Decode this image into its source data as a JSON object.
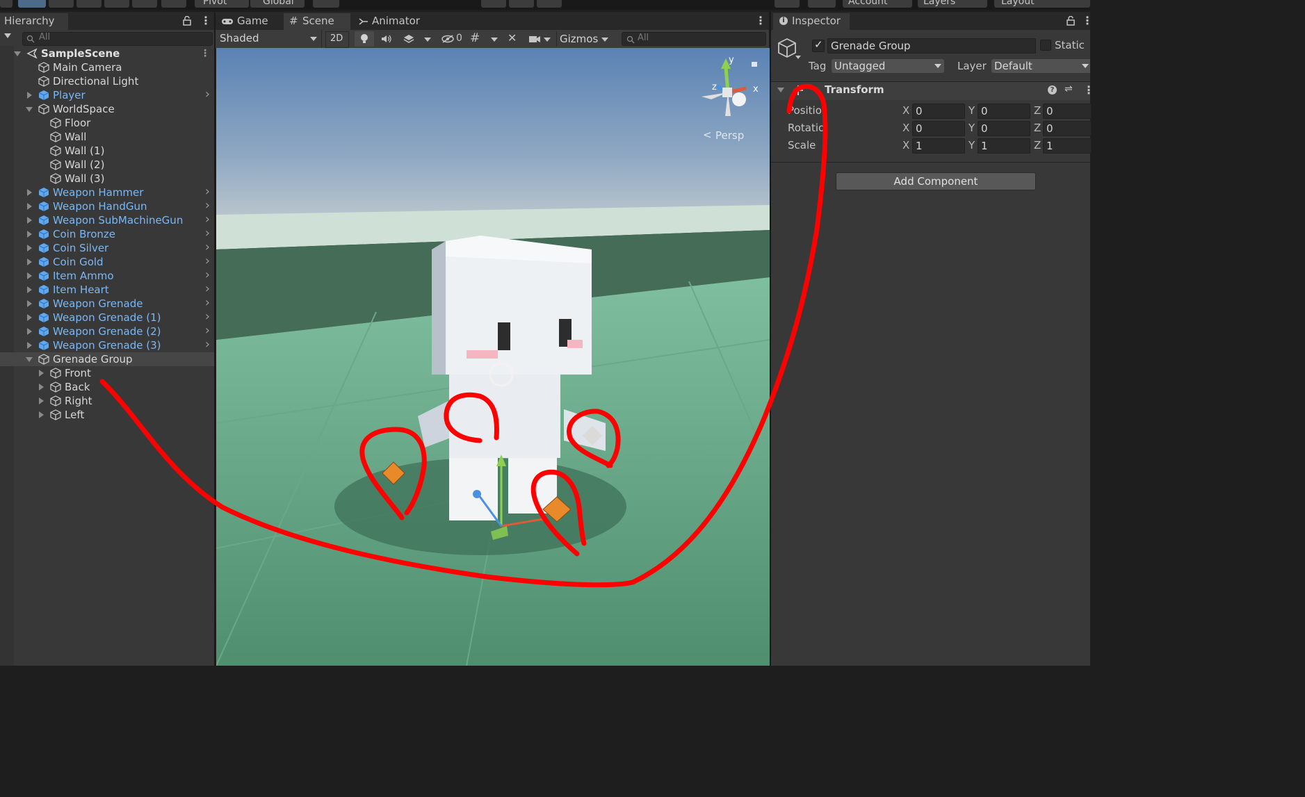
{
  "toolbar": {
    "pivot_label": "Pivot",
    "global_label": "Global",
    "account_label": "Account",
    "layers_label": "Layers",
    "layout_label": "Layout"
  },
  "hierarchy": {
    "title": "Hierarchy",
    "search_placeholder": "All",
    "items": [
      {
        "label": "SampleScene",
        "indent": 0,
        "fold": "down",
        "icon": "unity-scene-icon",
        "style": "bold",
        "chevron": false
      },
      {
        "label": "Main Camera",
        "indent": 1,
        "fold": "none",
        "icon": "gameobject-cube-icon",
        "style": "white",
        "chevron": false
      },
      {
        "label": "Directional Light",
        "indent": 1,
        "fold": "none",
        "icon": "gameobject-cube-icon",
        "style": "white",
        "chevron": false
      },
      {
        "label": "Player",
        "indent": 1,
        "fold": "right",
        "icon": "prefab-cube-icon",
        "style": "blue",
        "chevron": true
      },
      {
        "label": "WorldSpace",
        "indent": 1,
        "fold": "down",
        "icon": "gameobject-cube-icon",
        "style": "white",
        "chevron": false
      },
      {
        "label": "Floor",
        "indent": 2,
        "fold": "none",
        "icon": "gameobject-cube-icon",
        "style": "white",
        "chevron": false
      },
      {
        "label": "Wall",
        "indent": 2,
        "fold": "none",
        "icon": "gameobject-cube-icon",
        "style": "white",
        "chevron": false
      },
      {
        "label": "Wall (1)",
        "indent": 2,
        "fold": "none",
        "icon": "gameobject-cube-icon",
        "style": "white",
        "chevron": false
      },
      {
        "label": "Wall (2)",
        "indent": 2,
        "fold": "none",
        "icon": "gameobject-cube-icon",
        "style": "white",
        "chevron": false
      },
      {
        "label": "Wall (3)",
        "indent": 2,
        "fold": "none",
        "icon": "gameobject-cube-icon",
        "style": "white",
        "chevron": false
      },
      {
        "label": "Weapon Hammer",
        "indent": 1,
        "fold": "right",
        "icon": "prefab-cube-icon",
        "style": "blue",
        "chevron": true
      },
      {
        "label": "Weapon HandGun",
        "indent": 1,
        "fold": "right",
        "icon": "prefab-cube-icon",
        "style": "blue",
        "chevron": true
      },
      {
        "label": "Weapon SubMachineGun",
        "indent": 1,
        "fold": "right",
        "icon": "prefab-cube-icon",
        "style": "blue",
        "chevron": true
      },
      {
        "label": "Coin Bronze",
        "indent": 1,
        "fold": "right",
        "icon": "prefab-cube-icon",
        "style": "blue",
        "chevron": true
      },
      {
        "label": "Coin Silver",
        "indent": 1,
        "fold": "right",
        "icon": "prefab-cube-icon",
        "style": "blue",
        "chevron": true
      },
      {
        "label": "Coin Gold",
        "indent": 1,
        "fold": "right",
        "icon": "prefab-cube-icon",
        "style": "blue",
        "chevron": true
      },
      {
        "label": "Item Ammo",
        "indent": 1,
        "fold": "right",
        "icon": "prefab-cube-icon",
        "style": "blue",
        "chevron": true
      },
      {
        "label": "Item Heart",
        "indent": 1,
        "fold": "right",
        "icon": "prefab-cube-icon",
        "style": "blue",
        "chevron": true
      },
      {
        "label": "Weapon Grenade",
        "indent": 1,
        "fold": "right",
        "icon": "prefab-cube-icon",
        "style": "blue",
        "chevron": true
      },
      {
        "label": "Weapon Grenade (1)",
        "indent": 1,
        "fold": "right",
        "icon": "prefab-cube-icon",
        "style": "blue",
        "chevron": true
      },
      {
        "label": "Weapon Grenade (2)",
        "indent": 1,
        "fold": "right",
        "icon": "prefab-cube-icon",
        "style": "blue",
        "chevron": true
      },
      {
        "label": "Weapon Grenade (3)",
        "indent": 1,
        "fold": "right",
        "icon": "prefab-cube-icon",
        "style": "blue",
        "chevron": true
      },
      {
        "label": "Grenade Group",
        "indent": 1,
        "fold": "down",
        "icon": "gameobject-cube-icon",
        "style": "white",
        "chevron": false,
        "selected": true
      },
      {
        "label": "Front",
        "indent": 2,
        "fold": "right",
        "icon": "gameobject-cube-icon",
        "style": "white",
        "chevron": false
      },
      {
        "label": "Back",
        "indent": 2,
        "fold": "right",
        "icon": "gameobject-cube-icon",
        "style": "white",
        "chevron": false
      },
      {
        "label": "Right",
        "indent": 2,
        "fold": "right",
        "icon": "gameobject-cube-icon",
        "style": "white",
        "chevron": false
      },
      {
        "label": "Left",
        "indent": 2,
        "fold": "right",
        "icon": "gameobject-cube-icon",
        "style": "white",
        "chevron": false
      }
    ]
  },
  "scene": {
    "tabs": {
      "game": "Game",
      "scene": "Scene",
      "animator": "Animator"
    },
    "shading_mode": "Shaded",
    "mode_2d": "2D",
    "hidden_count": "0",
    "gizmos_label": "Gizmos",
    "search_placeholder": "All",
    "perspective_label": "Persp",
    "axis_labels": {
      "y": "y",
      "x": "x",
      "z": "z"
    }
  },
  "inspector": {
    "title": "Inspector",
    "object_name": "Grenade Group",
    "active_checked": true,
    "static_label": "Static",
    "tag_label": "Tag",
    "tag_value": "Untagged",
    "layer_label": "Layer",
    "layer_value": "Default",
    "transform": {
      "title": "Transform",
      "rows": [
        {
          "label": "Position",
          "x": "0",
          "y": "0",
          "z": "0"
        },
        {
          "label": "Rotation",
          "x": "0",
          "y": "0",
          "z": "0"
        },
        {
          "label": "Scale",
          "x": "1",
          "y": "1",
          "z": "1"
        }
      ]
    },
    "add_component_label": "Add Component"
  },
  "colors": {
    "prefab_blue": "#7ab8f5",
    "annotation_red": "#ff0000",
    "grenade_orange": "#e8892a"
  }
}
